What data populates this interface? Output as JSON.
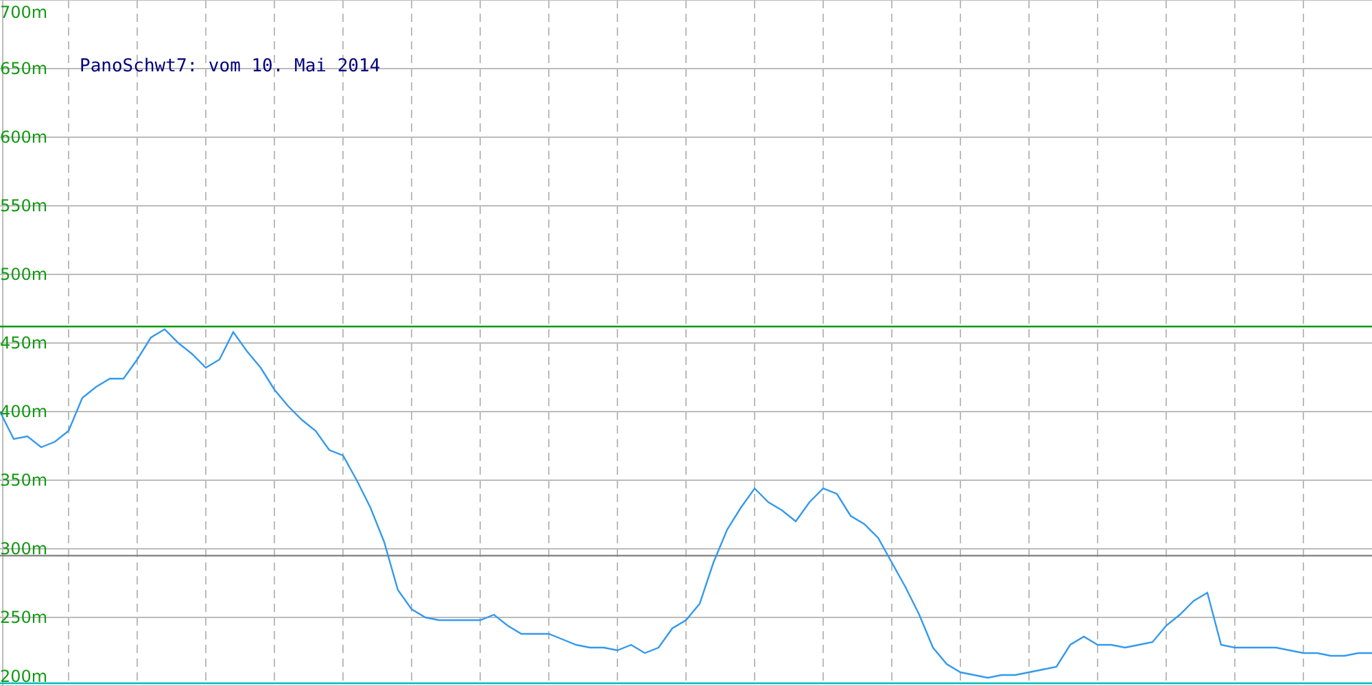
{
  "chart": {
    "chart_data": {
      "type": "line",
      "title": "PanoSchwt7: vom 10. Mai 2014",
      "ylim": [
        200,
        700
      ],
      "grid": true,
      "yticks": [
        {
          "value": 200,
          "label": "200m"
        },
        {
          "value": 250,
          "label": "250m"
        },
        {
          "value": 300,
          "label": "300m"
        },
        {
          "value": 350,
          "label": "350m"
        },
        {
          "value": 400,
          "label": "400m"
        },
        {
          "value": 450,
          "label": "450m"
        },
        {
          "value": 500,
          "label": "500m"
        },
        {
          "value": 550,
          "label": "550m"
        },
        {
          "value": 600,
          "label": "600m"
        },
        {
          "value": 650,
          "label": "650m"
        },
        {
          "value": 700,
          "label": "700m"
        }
      ],
      "series": [
        {
          "color": "#009900",
          "values": [
            462,
            462,
            462,
            462,
            462,
            462,
            462,
            462,
            462,
            462,
            462,
            462,
            462,
            462,
            462,
            462,
            462,
            462,
            462,
            462,
            462,
            462,
            462,
            462,
            462,
            462,
            462,
            462,
            462,
            462,
            462,
            462,
            462,
            462,
            462,
            462,
            462,
            462,
            462,
            462,
            462,
            462,
            462,
            462,
            462,
            462,
            462,
            462,
            462,
            462,
            462,
            462,
            462,
            462,
            462,
            462,
            462,
            462,
            462,
            462,
            462,
            462,
            462,
            462,
            462,
            462,
            462,
            462,
            462,
            462,
            462,
            462,
            462,
            462,
            462,
            462,
            462,
            462,
            462,
            462,
            462,
            462,
            462,
            462,
            462,
            462,
            462,
            462,
            462,
            462,
            462,
            462,
            462,
            462,
            462,
            462,
            462,
            462,
            462,
            462,
            462
          ]
        },
        {
          "color": "#888888",
          "values": [
            295,
            295,
            295,
            295,
            295,
            295,
            295,
            295,
            295,
            295,
            295,
            295,
            295,
            295,
            295,
            295,
            295,
            295,
            295,
            295,
            295,
            295,
            295,
            295,
            295,
            295,
            295,
            295,
            295,
            295,
            295,
            295,
            295,
            295,
            295,
            295,
            295,
            295,
            295,
            295,
            295,
            295,
            295,
            295,
            295,
            295,
            295,
            295,
            295,
            295,
            295,
            295,
            295,
            295,
            295,
            295,
            295,
            295,
            295,
            295,
            295,
            295,
            295,
            295,
            295,
            295,
            295,
            295,
            295,
            295,
            295,
            295,
            295,
            295,
            295,
            295,
            295,
            295,
            295,
            295,
            295,
            295,
            295,
            295,
            295,
            295,
            295,
            295,
            295,
            295,
            295,
            295,
            295,
            295,
            295,
            295,
            295,
            295,
            295,
            295,
            295
          ]
        },
        {
          "color": "#00bbbb",
          "values": [
            202,
            202,
            202,
            202,
            202,
            202,
            202,
            202,
            202,
            202,
            202,
            202,
            202,
            202,
            202,
            202,
            202,
            202,
            202,
            202,
            202,
            202,
            202,
            202,
            202,
            202,
            202,
            202,
            202,
            202,
            202,
            202,
            202,
            202,
            202,
            202,
            202,
            202,
            202,
            202,
            202,
            202,
            202,
            202,
            202,
            202,
            202,
            202,
            202,
            202,
            202,
            202,
            202,
            202,
            202,
            202,
            202,
            202,
            202,
            202,
            202,
            202,
            202,
            202,
            202,
            202,
            202,
            202,
            202,
            202,
            202,
            202,
            202,
            202,
            202,
            202,
            202,
            202,
            202,
            202,
            202,
            202,
            202,
            202,
            202,
            202,
            202,
            202,
            202,
            202,
            202,
            202,
            202,
            202,
            202,
            202,
            202,
            202,
            202,
            202,
            202
          ]
        },
        {
          "color": "#3399ee",
          "values": [
            400,
            380,
            382,
            374,
            378,
            386,
            410,
            418,
            424,
            424,
            438,
            454,
            460,
            450,
            442,
            432,
            438,
            458,
            444,
            432,
            416,
            404,
            394,
            386,
            372,
            368,
            350,
            330,
            305,
            270,
            256,
            250,
            248,
            248,
            248,
            248,
            252,
            244,
            238,
            238,
            238,
            234,
            230,
            228,
            228,
            226,
            230,
            224,
            228,
            242,
            248,
            260,
            290,
            314,
            330,
            344,
            334,
            328,
            320,
            334,
            344,
            340,
            324,
            318,
            308,
            290,
            272,
            252,
            228,
            216,
            210,
            208,
            206,
            208,
            208,
            210,
            212,
            214,
            230,
            236,
            230,
            230,
            228,
            230,
            232,
            244,
            252,
            262,
            268,
            230,
            228,
            228,
            228,
            228,
            226,
            224,
            224,
            222,
            222,
            224,
            224
          ]
        }
      ]
    }
  }
}
